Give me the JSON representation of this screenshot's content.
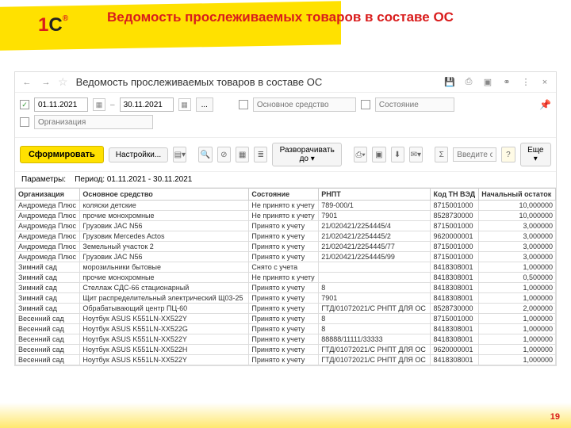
{
  "pageNumber": "19",
  "logo": {
    "one": "1",
    "c": "C"
  },
  "slideTitle": "Ведомость прослеживаемых товаров в составе ОС",
  "windowTitle": "Ведомость прослеживаемых товаров в составе ОС",
  "filters": {
    "dateFrom": "01.11.2021",
    "dateTo": "30.11.2021",
    "osPlaceholder": "Основное средство",
    "statePlaceholder": "Состояние",
    "orgPlaceholder": "Организация",
    "dash": "–",
    "dots": "..."
  },
  "actions": {
    "generate": "Сформировать",
    "settings": "Настройки...",
    "expand": "Разворачивать до",
    "find": "Введите с",
    "more": "Еще"
  },
  "paramsLabel": "Параметры:",
  "periodLabel": "Период: 01.11.2021 - 30.11.2021",
  "columns": [
    "Организация",
    "Основное средство",
    "Состояние",
    "РНПТ",
    "Код ТН ВЭД",
    "Начальный остаток"
  ],
  "rows": [
    [
      "Андромеда Плюс",
      "коляски детские",
      "Не принято к учету",
      "789-000/1",
      "8715001000",
      "10,000000"
    ],
    [
      "Андромеда Плюс",
      "прочие монохромные",
      "Не принято к учету",
      "7901",
      "8528730000",
      "10,000000"
    ],
    [
      "Андромеда Плюс",
      "Грузовик JAC N56",
      "Принято к учету",
      "21/020421/2254445/4",
      "8715001000",
      "3,000000"
    ],
    [
      "Андромеда Плюс",
      "Грузовик Mercedes Actos",
      "Принято к учету",
      "21/020421/2254445/2",
      "9620000001",
      "3,000000"
    ],
    [
      "Андромеда Плюс",
      "Земельный участок 2",
      "Принято к учету",
      "21/020421/2254445/77",
      "8715001000",
      "3,000000"
    ],
    [
      "Андромеда Плюс",
      "Грузовик JAC N56",
      "Принято к учету",
      "21/020421/2254445/99",
      "8715001000",
      "3,000000"
    ],
    [
      "Зимний сад",
      "морозильники бытовые",
      "Снято с учета",
      "",
      "8418308001",
      "1,000000"
    ],
    [
      "Зимний сад",
      "прочие монохромные",
      "Не принято к учету",
      "",
      "8418308001",
      "0,500000"
    ],
    [
      "Зимний сад",
      "Стеллаж СДС-66 стационарный",
      "Принято к учету",
      "8",
      "8418308001",
      "1,000000"
    ],
    [
      "Зимний сад",
      "Щит распределительный электрический Щ03-25",
      "Принято к учету",
      "7901",
      "8418308001",
      "1,000000"
    ],
    [
      "Зимний сад",
      "Обрабатывающий центр ПЦ-60",
      "Принято к учету",
      "ГТД/01072021/С РНПТ ДЛЯ ОС",
      "8528730000",
      "2,000000"
    ],
    [
      "Весенний сад",
      "Ноутбук ASUS K551LN-XX522Y",
      "Принято к учету",
      "8",
      "8715001000",
      "1,000000"
    ],
    [
      "Весенний сад",
      "Ноутбук ASUS K551LN-XX522G",
      "Принято к учету",
      "8",
      "8418308001",
      "1,000000"
    ],
    [
      "Весенний сад",
      "Ноутбук ASUS K551LN-XX522Y",
      "Принято к учету",
      "88888/11111/33333",
      "8418308001",
      "1,000000"
    ],
    [
      "Весенний сад",
      "Ноутбук ASUS K551LN-XX522H",
      "Принято к учету",
      "ГТД/01072021/С РНПТ ДЛЯ ОС",
      "9620000001",
      "1,000000"
    ],
    [
      "Весенний сад",
      "Ноутбук ASUS K551LN-XX522Y",
      "Принято к учету",
      "ГТД/01072021/С РНПТ ДЛЯ ОС",
      "8418308001",
      "1,000000"
    ]
  ]
}
